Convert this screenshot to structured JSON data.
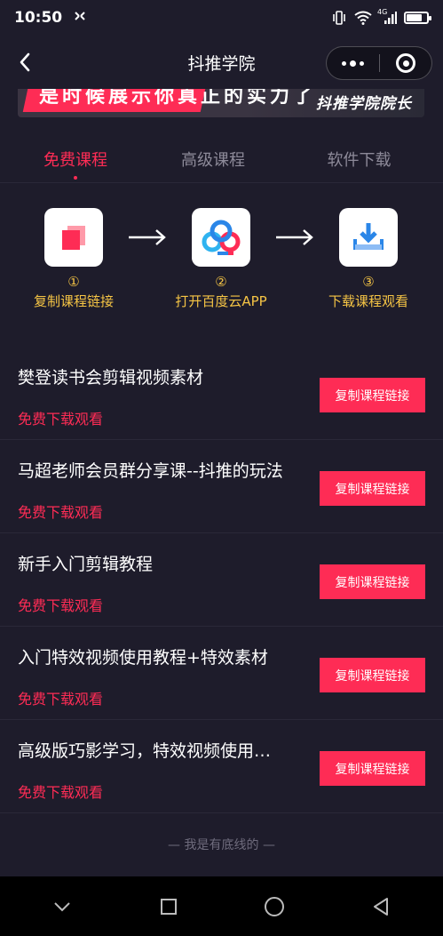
{
  "status_bar": {
    "time": "10:50",
    "network": "4G"
  },
  "nav": {
    "title": "抖推学院"
  },
  "banner": {
    "left_text": "是时候展示你真正的实力了",
    "right_text": "抖推学院院长"
  },
  "tabs": [
    {
      "label": "免费课程",
      "active": true
    },
    {
      "label": "高级课程",
      "active": false
    },
    {
      "label": "软件下载",
      "active": false
    }
  ],
  "steps": [
    {
      "num": "①",
      "label": "复制课程链接",
      "icon": "copy-icon"
    },
    {
      "num": "②",
      "label": "打开百度云APP",
      "icon": "baidu-cloud-icon"
    },
    {
      "num": "③",
      "label": "下载课程观看",
      "icon": "download-icon"
    }
  ],
  "courses": [
    {
      "title": "樊登读书会剪辑视频素材",
      "subtitle": "免费下载观看",
      "button": "复制课程链接"
    },
    {
      "title": "马超老师会员群分享课--抖推的玩法",
      "subtitle": "免费下载观看",
      "button": "复制课程链接"
    },
    {
      "title": "新手入门剪辑教程",
      "subtitle": "免费下载观看",
      "button": "复制课程链接"
    },
    {
      "title": "入门特效视频使用教程+特效素材",
      "subtitle": "免费下载观看",
      "button": "复制课程链接"
    },
    {
      "title": "高级版巧影学习，特效视频使用…",
      "subtitle": "免费下载观看",
      "button": "复制课程链接"
    }
  ],
  "footer": {
    "note": "— 我是有底线的 —"
  },
  "colors": {
    "background": "#1e1c2b",
    "accent": "#fe2c55",
    "step_text": "#f6c545",
    "inactive_tab": "#8d8a99"
  }
}
